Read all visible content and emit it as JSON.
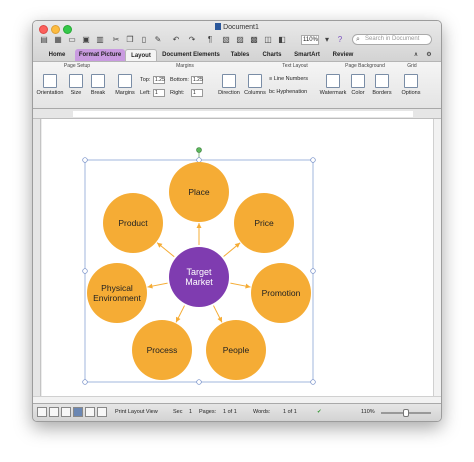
{
  "window": {
    "title": "Document1"
  },
  "toolbar": {
    "zoom_value": "110%",
    "search_placeholder": "Search in Document"
  },
  "tabs": [
    "Home",
    "Format Picture",
    "Layout",
    "Document Elements",
    "Tables",
    "Charts",
    "SmartArt",
    "Review"
  ],
  "ribbon": {
    "groups": {
      "page_setup": "Page Setup",
      "margins": "Margins",
      "text_layout": "Text Layout",
      "page_background": "Page Background",
      "grid": "Grid"
    },
    "buttons": {
      "orientation": "Orientation",
      "size": "Size",
      "break": "Break",
      "margins": "Margins",
      "direction": "Direction",
      "columns": "Columns",
      "line_numbers": "Line Numbers",
      "hyphenation": "Hyphenation",
      "watermark": "Watermark",
      "color": "Color",
      "borders": "Borders",
      "options": "Options"
    },
    "margin_fields": {
      "top_label": "Top:",
      "top_value": "1.25",
      "bottom_label": "Bottom:",
      "bottom_value": "1.25",
      "left_label": "Left:",
      "left_value": "1",
      "right_label": "Right:",
      "right_value": "1"
    }
  },
  "diagram": {
    "center": {
      "label_line1": "Target",
      "label_line2": "Market",
      "color": "#7f3cb0"
    },
    "node_color": "#f5ac35",
    "nodes": [
      {
        "label_line1": "Place",
        "label_line2": ""
      },
      {
        "label_line1": "Price",
        "label_line2": ""
      },
      {
        "label_line1": "Promotion",
        "label_line2": ""
      },
      {
        "label_line1": "People",
        "label_line2": ""
      },
      {
        "label_line1": "Process",
        "label_line2": ""
      },
      {
        "label_line1": "Physical",
        "label_line2": "Environment"
      },
      {
        "label_line1": "Product",
        "label_line2": ""
      }
    ],
    "selection_color": "#8aa5d6"
  },
  "statusbar": {
    "view": "Print Layout View",
    "sec_label": "Sec",
    "sec_value": "1",
    "pages_label": "Pages:",
    "pages_value": "1 of 1",
    "words_label": "Words:",
    "words_value": "1 of 1",
    "zoom": "110%"
  }
}
